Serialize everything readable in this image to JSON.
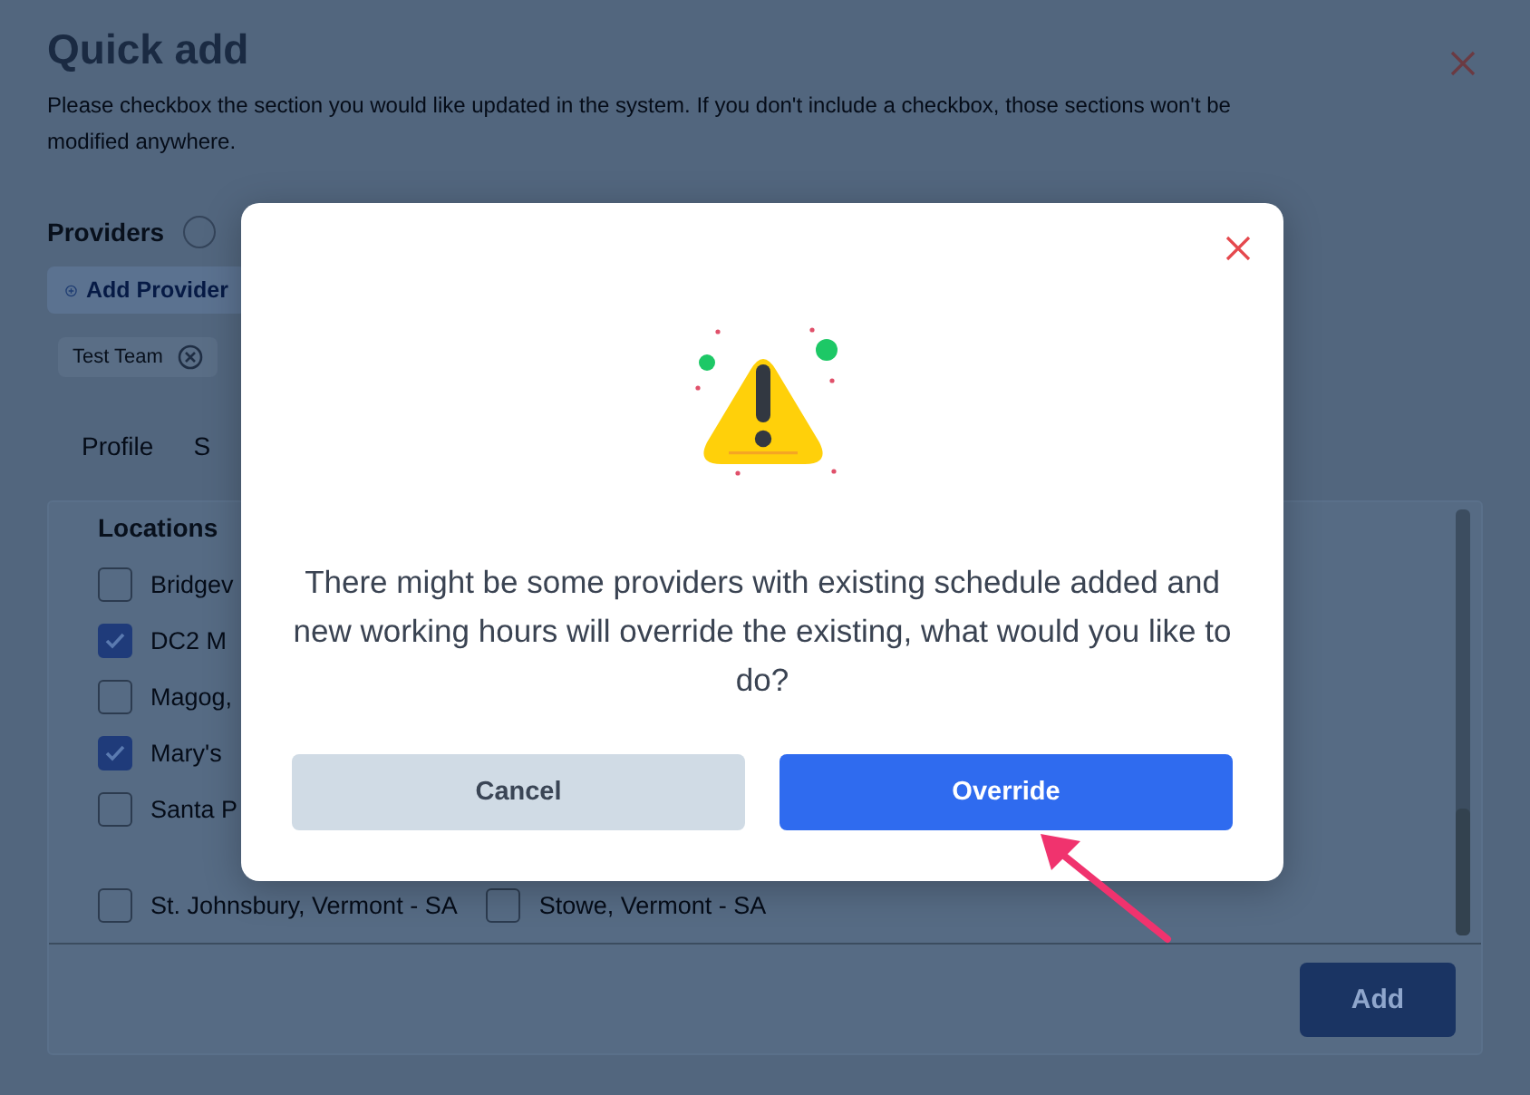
{
  "page": {
    "title": "Quick add",
    "description": "Please checkbox the section you would like updated in the system. If you don't include a checkbox, those sections won't be modified anywhere.",
    "providers": {
      "label": "Providers",
      "add_button": "Add Provider",
      "chips": [
        {
          "label": "Test Team"
        }
      ]
    },
    "tabs": [
      {
        "label": "Profile"
      },
      {
        "label": "S"
      }
    ],
    "locations": {
      "heading": "Locations",
      "rows": [
        {
          "cells": [
            {
              "label": "Bridgev",
              "checked": false
            }
          ]
        },
        {
          "cells": [
            {
              "label": "DC2 M",
              "checked": true
            }
          ]
        },
        {
          "cells": [
            {
              "label": "Magog,",
              "checked": false
            }
          ]
        },
        {
          "cells": [
            {
              "label": "Mary's",
              "checked": true
            }
          ]
        },
        {
          "cells": [
            {
              "label": "Santa P",
              "checked": false
            }
          ]
        },
        {
          "cells": [
            {
              "label": "St. Johnsbury, Vermont - SA",
              "checked": false
            },
            {
              "label": "Stowe, Vermont - SA",
              "checked": false
            }
          ]
        }
      ]
    },
    "add_button": "Add"
  },
  "dialog": {
    "message": "There might be some providers with existing schedule added and new working hours will override the existing, what would you like to do?",
    "buttons": [
      {
        "label": "Cancel",
        "kind": "secondary"
      },
      {
        "label": "Override",
        "kind": "primary"
      }
    ]
  }
}
